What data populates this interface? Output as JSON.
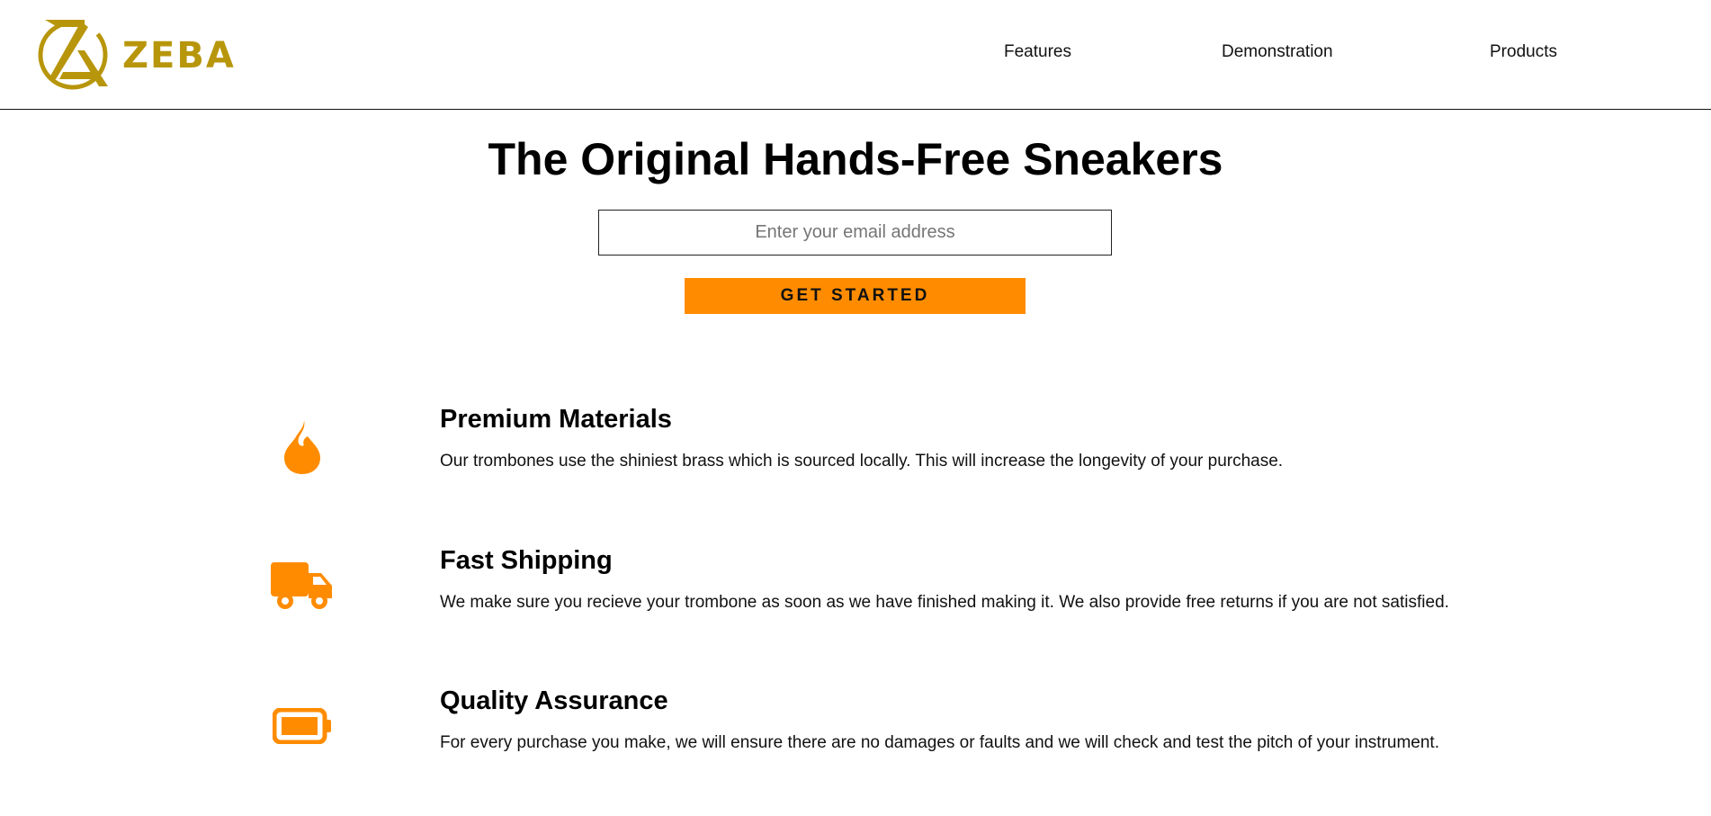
{
  "brand": {
    "name": "ZEBA",
    "color": "#b8960c"
  },
  "nav": {
    "items": [
      {
        "label": "Features"
      },
      {
        "label": "Demonstration"
      },
      {
        "label": "Products"
      }
    ]
  },
  "hero": {
    "title": "The Original Hands-Free Sneakers",
    "email_placeholder": "Enter your email address",
    "email_value": "",
    "cta_label": "GET STARTED",
    "accent_color": "#ff8c00"
  },
  "features": [
    {
      "icon": "flame-icon",
      "title": "Premium Materials",
      "description": "Our trombones use the shiniest brass which is sourced locally. This will increase the longevity of your purchase."
    },
    {
      "icon": "truck-icon",
      "title": "Fast Shipping",
      "description": "We make sure you recieve your trombone as soon as we have finished making it. We also provide free returns if you are not satisfied."
    },
    {
      "icon": "battery-icon",
      "title": "Quality Assurance",
      "description": "For every purchase you make, we will ensure there are no damages or faults and we will check and test the pitch of your instrument."
    }
  ]
}
